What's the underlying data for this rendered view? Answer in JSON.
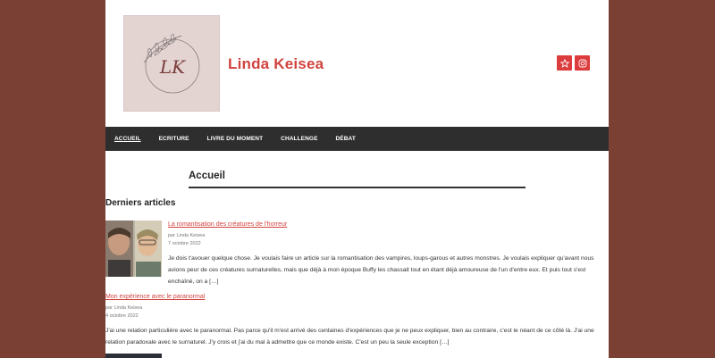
{
  "site": {
    "title": "Linda Keisea",
    "logo_text": "LK",
    "logo_alt": "Linda Keisea logo"
  },
  "social": [
    {
      "icon": "star-icon"
    },
    {
      "icon": "instagram-icon"
    }
  ],
  "nav": {
    "items": [
      {
        "label": "ACCUEIL",
        "active": true
      },
      {
        "label": "ECRITURE"
      },
      {
        "label": "LIVRE DU MOMENT"
      },
      {
        "label": "CHALLENGE"
      },
      {
        "label": "DÉBAT"
      }
    ]
  },
  "page": {
    "heading": "Accueil"
  },
  "recent": {
    "title": "Derniers articles",
    "posts": [
      {
        "title": "La romantisation des créatures de l'horreur",
        "author": "par Linda Keisea",
        "date": "7 octobre 2022",
        "excerpt": "Je dois t'avouer quelque chose. Je voulais faire un article sur la romantisation des vampires, loups-garous et autres monstres. Je voulais expliquer qu'avant nous avions peur de ces créatures surnaturelles, mais que déjà à mon époque Buffy les chassait tout en étant déjà amoureuse de l'un d'entre eux. Et puis tout s'est enchaîné, on a […]"
      },
      {
        "title": "Mon expérience avec le paranormal",
        "author": "par Linda Keisea",
        "date": "4 octobre 2022",
        "excerpt": "J'ai une relation particulière avec le paranormal. Pas parce qu'il m'est arrivé des centaines d'expériences que je ne peux expliquer, bien au contraire, c'est le néant de ce côté là. J'ai une relation paradoxale avec le surnaturel. J'y crois et j'ai du mal à admettre que ce monde existe. C'est un peu la seule exception […]"
      }
    ]
  },
  "colors": {
    "background": "#7a4034",
    "accent": "#d1433f",
    "nav_bg": "#2e2e2e"
  }
}
